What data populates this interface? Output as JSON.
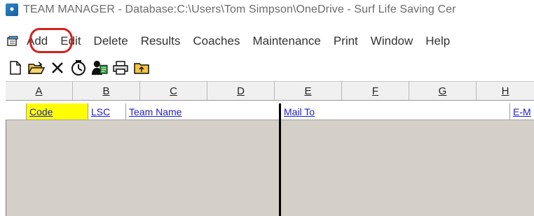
{
  "titlebar": {
    "title": "TEAM MANAGER - Database:C:\\Users\\Tom Simpson\\OneDrive - Surf Life Saving Cer",
    "icon": "app-logo-icon"
  },
  "menu": {
    "items": [
      "Add",
      "Edit",
      "Delete",
      "Results",
      "Coaches",
      "Maintenance",
      "Print",
      "Window",
      "Help"
    ],
    "highlighted": "Add",
    "highlight_color": "#d6211e"
  },
  "toolbar": {
    "buttons": [
      "new-file-icon",
      "open-folder-icon",
      "delete-x-icon",
      "clock-icon",
      "coach-icon",
      "print-icon",
      "folder-up-icon"
    ]
  },
  "columns": {
    "letters": [
      "A",
      "B",
      "C",
      "D",
      "E",
      "F",
      "G",
      "H"
    ]
  },
  "grid": {
    "headers": [
      "Code",
      "LSC",
      "Team Name",
      "Mail To",
      "E-M"
    ],
    "active_header": "Code",
    "active_color": "#ffff00",
    "link_color": "#1f1fcc",
    "background": "#d4d0c8"
  }
}
